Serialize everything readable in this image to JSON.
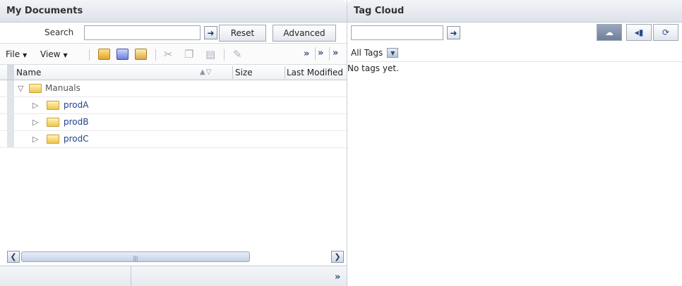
{
  "docs": {
    "title": "My Documents",
    "search": {
      "label": "Search",
      "value": "",
      "reset_label": "Reset",
      "advanced_label": "Advanced"
    },
    "toolbar": {
      "file_menu": "File",
      "view_menu": "View"
    },
    "columns": {
      "name": "Name",
      "size": "Size",
      "modified": "Last Modified"
    },
    "tree": {
      "root": {
        "label": "Manuals",
        "expanded": true
      },
      "children": [
        {
          "label": "prodA"
        },
        {
          "label": "prodB"
        },
        {
          "label": "prodC"
        }
      ]
    }
  },
  "tags": {
    "title": "Tag Cloud",
    "search_value": "",
    "filter_selected": "All Tags",
    "empty_message": "No tags yet.",
    "views": [
      {
        "icon": "cloud-view-icon",
        "active": true
      },
      {
        "icon": "tag-list-icon",
        "active": false
      },
      {
        "icon": "tag-refresh-icon",
        "active": false
      }
    ]
  }
}
